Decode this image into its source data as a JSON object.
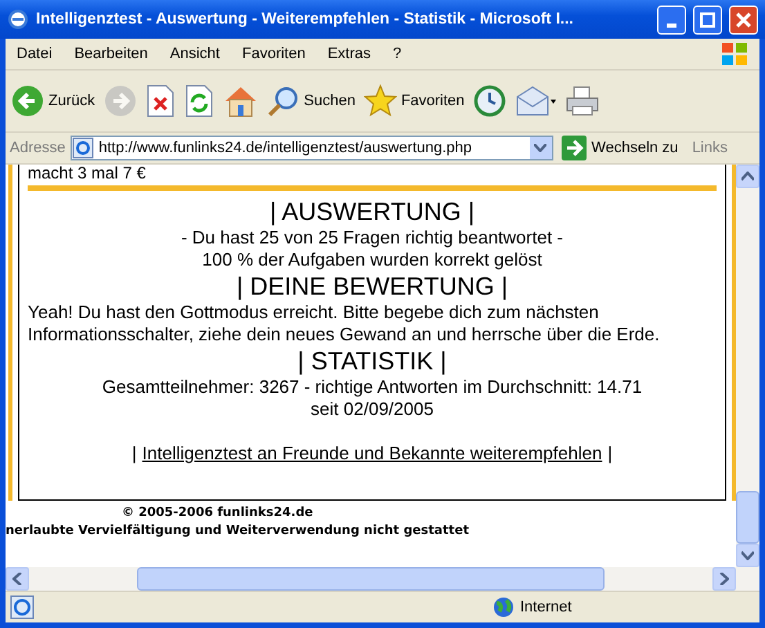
{
  "window": {
    "title": "Intelligenztest - Auswertung - Weiterempfehlen - Statistik - Microsoft I..."
  },
  "menu": [
    "Datei",
    "Bearbeiten",
    "Ansicht",
    "Favoriten",
    "Extras",
    "?"
  ],
  "toolbar": [
    {
      "kind": "back",
      "label": "Zurück",
      "disabled": false
    },
    {
      "kind": "forward",
      "disabled": true
    },
    {
      "kind": "stop",
      "disabled": false
    },
    {
      "kind": "refresh",
      "disabled": false
    },
    {
      "kind": "home",
      "disabled": false
    },
    {
      "kind": "search",
      "label": "Suchen",
      "disabled": false
    },
    {
      "kind": "favorites",
      "label": "Favoriten",
      "disabled": false
    },
    {
      "kind": "history",
      "disabled": false
    },
    {
      "kind": "mail",
      "disabled": false
    },
    {
      "kind": "print",
      "disabled": false
    }
  ],
  "address": {
    "label": "Adresse",
    "value": "http://www.funlinks24.de/intelligenztest/auswertung.php",
    "go": "Wechseln zu",
    "links": "Links"
  },
  "page": {
    "top_text": "macht 3 mal 7 €",
    "sections": [
      {
        "heading": "| AUSWERTUNG |",
        "lines": [
          "- Du hast 25 von 25 Fragen richtig beantwortet -",
          "100 % der Aufgaben wurden korrekt gelöst"
        ],
        "kind": "centered"
      },
      {
        "heading": "| DEINE BEWERTUNG |",
        "lines": [
          "Yeah! Du hast den Gottmodus erreicht. Bitte begebe dich zum nächsten Informationsschalter, ziehe dein neues Gewand an und herrsche über die Erde."
        ],
        "kind": "paragraph"
      },
      {
        "heading": "| STATISTIK |",
        "lines": [
          "Gesamtteilnehmer: 3267 - richtige Antworten im Durchschnitt: 14.71",
          "seit 02/09/2005"
        ],
        "kind": "centered"
      }
    ],
    "link_prefix": "|",
    "link": "Intelligenztest an Freunde und Bekannte weiterempfehlen",
    "link_suffix": "|",
    "copyright": "© 2005-2006 funlinks24.de",
    "notice": "nerlaubte Vervielfältigung und Weiterverwendung nicht gestattet"
  },
  "status": {
    "zone": "Internet"
  }
}
